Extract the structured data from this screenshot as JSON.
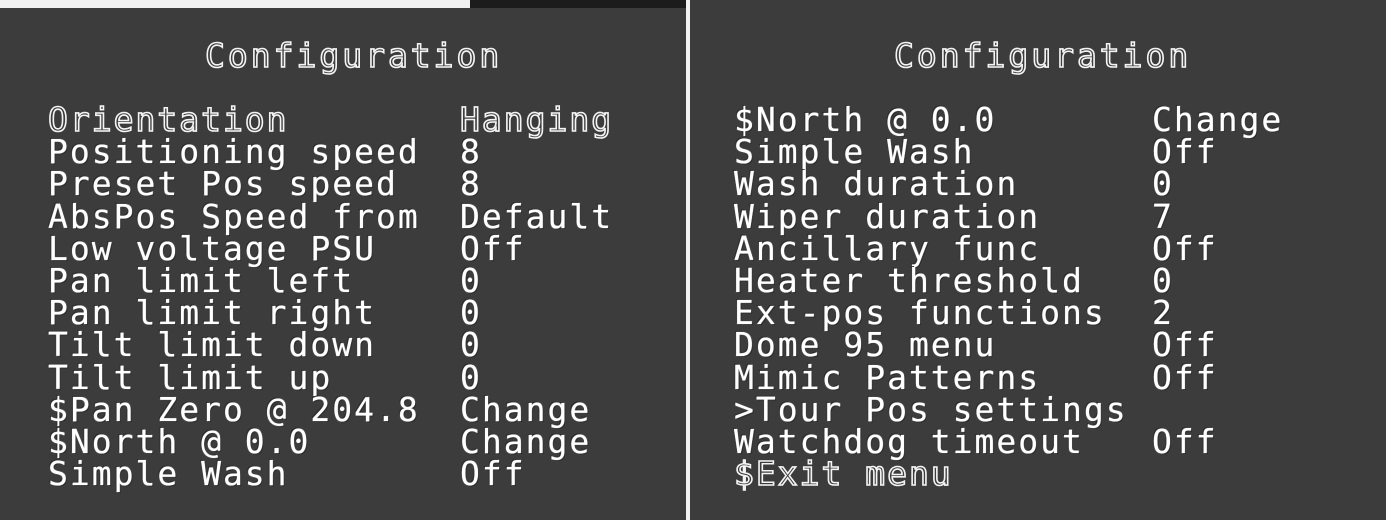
{
  "left_panel": {
    "title": "Configuration",
    "items": [
      {
        "label": "Orientation",
        "value": "Hanging"
      },
      {
        "label": "Positioning speed",
        "value": "8"
      },
      {
        "label": "Preset Pos speed",
        "value": "8"
      },
      {
        "label": "AbsPos Speed from",
        "value": "Default"
      },
      {
        "label": "Low voltage PSU",
        "value": "Off"
      },
      {
        "label": "Pan limit left",
        "value": "0"
      },
      {
        "label": "Pan limit right",
        "value": "0"
      },
      {
        "label": "Tilt limit down",
        "value": "0"
      },
      {
        "label": "Tilt limit up",
        "value": "0"
      },
      {
        "label": "$Pan Zero @ 204.8",
        "value": "Change"
      },
      {
        "label": "$North @ 0.0",
        "value": "Change"
      },
      {
        "label": "Simple Wash",
        "value": "Off"
      }
    ]
  },
  "right_panel": {
    "title": "Configuration",
    "items": [
      {
        "label": "$North @ 0.0",
        "value": "Change"
      },
      {
        "label": "Simple Wash",
        "value": "Off"
      },
      {
        "label": "Wash duration",
        "value": "0"
      },
      {
        "label": "Wiper duration",
        "value": "7"
      },
      {
        "label": "Ancillary func",
        "value": "Off"
      },
      {
        "label": "Heater threshold",
        "value": "0"
      },
      {
        "label": "Ext-pos functions",
        "value": "2"
      },
      {
        "label": "Dome 95 menu",
        "value": "Off"
      },
      {
        "label": "Mimic Patterns",
        "value": "Off"
      },
      {
        "label": ">Tour Pos settings",
        "value": ""
      },
      {
        "label": "Watchdog timeout",
        "value": "Off"
      },
      {
        "label": "$Exit menu",
        "value": ""
      }
    ]
  },
  "colors": {
    "osd_background": "#3c3c3c",
    "osd_text": "#ffffff"
  }
}
